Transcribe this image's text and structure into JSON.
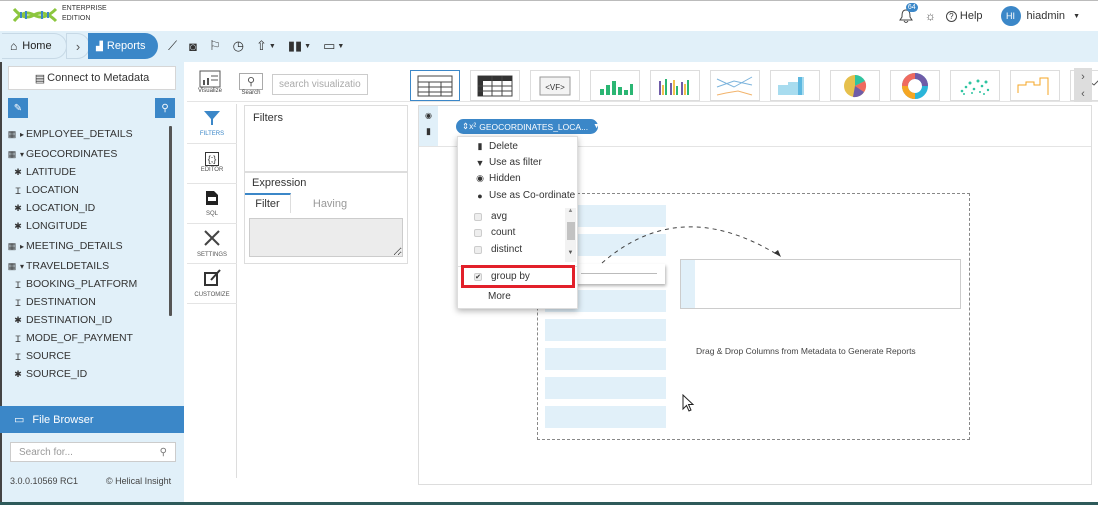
{
  "app": {
    "edition_line1": "ENTERPRISE",
    "edition_line2": "EDITION",
    "brand_colors": {
      "primary": "#3b87c8",
      "light_bg": "#e1f0f9",
      "logo_green": "#8cc63e",
      "highlight_red": "#e2202a"
    }
  },
  "topbar": {
    "notifications_count": "64",
    "help_label": "Help",
    "user_initials": "HI",
    "username": "hiadmin"
  },
  "nav": {
    "home_label": "Home",
    "reports_label": "Reports",
    "toolbar_icons": [
      "line-chart-icon",
      "preview-icon",
      "presentation-icon",
      "history-icon",
      "export-icon",
      "layout-icon",
      "save-icon"
    ]
  },
  "left_panel": {
    "connect_label": "Connect to Metadata",
    "tree": [
      {
        "type": "table",
        "expanded": false,
        "label": "EMPLOYEE_DETAILS"
      },
      {
        "type": "table",
        "expanded": true,
        "label": "GEOCORDINATES"
      },
      {
        "type": "number",
        "label": "LATITUDE"
      },
      {
        "type": "text",
        "label": "LOCATION"
      },
      {
        "type": "number",
        "label": "LOCATION_ID"
      },
      {
        "type": "number",
        "label": "LONGITUDE"
      },
      {
        "type": "table",
        "expanded": false,
        "label": "MEETING_DETAILS"
      },
      {
        "type": "table",
        "expanded": true,
        "label": "TRAVELDETAILS"
      },
      {
        "type": "text",
        "label": "BOOKING_PLATFORM"
      },
      {
        "type": "text",
        "label": "DESTINATION"
      },
      {
        "type": "number",
        "label": "DESTINATION_ID"
      },
      {
        "type": "text",
        "label": "MODE_OF_PAYMENT"
      },
      {
        "type": "text",
        "label": "SOURCE"
      },
      {
        "type": "number",
        "label": "SOURCE_ID"
      }
    ],
    "file_browser_label": "File Browser",
    "search_placeholder": "Search for...",
    "version": "3.0.0.10569 RC1",
    "copyright": "© Helical Insight"
  },
  "viz_toolbar": {
    "visualize_label": "Visualize",
    "search_label": "Search",
    "search_placeholder": "search visualizatio",
    "chart_types": [
      "table",
      "crosstab",
      "custom-vf",
      "bar",
      "grouped-bar",
      "line-area",
      "area",
      "pie",
      "donut",
      "scatter",
      "step",
      "sparkline"
    ]
  },
  "side_tools": [
    {
      "label": "FILTERS",
      "icon": "funnel-icon"
    },
    {
      "label": "EDITOR",
      "icon": "braces-icon"
    },
    {
      "label": "SQL",
      "icon": "sql-file-icon"
    },
    {
      "label": "SETTINGS",
      "icon": "tools-icon"
    },
    {
      "label": "CUSTOMIZE",
      "icon": "customize-icon"
    }
  ],
  "filters_panel": {
    "title": "Filters",
    "expression_title": "Expression",
    "tab_filter": "Filter",
    "tab_having": "Having"
  },
  "canvas": {
    "field_pill": "GEOCORDINATES_LOCA...",
    "drop_hint": "Drag & Drop Columns from Metadata to Generate Reports"
  },
  "context_menu": {
    "actions": [
      {
        "label": "Delete",
        "icon": "trash-icon"
      },
      {
        "label": "Use as filter",
        "icon": "filter-icon"
      },
      {
        "label": "Hidden",
        "icon": "eye-slash-icon"
      },
      {
        "label": "Use as Co-ordinate",
        "icon": "globe-icon"
      }
    ],
    "aggregations": [
      {
        "label": "avg",
        "checked": false
      },
      {
        "label": "count",
        "checked": false
      },
      {
        "label": "distinct",
        "checked": false
      }
    ],
    "group_by": {
      "label": "group by",
      "checked": true
    },
    "more_label": "More"
  }
}
